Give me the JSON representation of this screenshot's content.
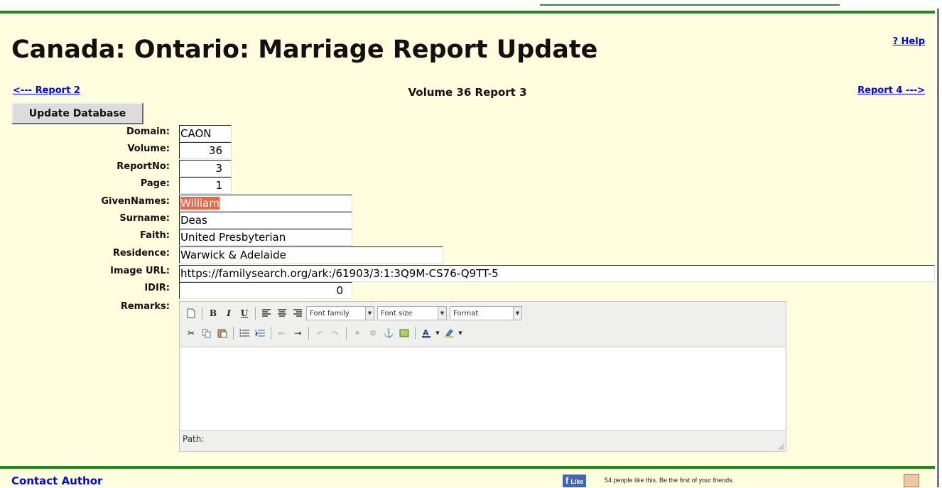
{
  "header": {
    "title": "Canada: Ontario: Marriage Report Update",
    "help_link": "? Help"
  },
  "nav": {
    "prev_link": "<--- Report 2",
    "next_link": "Report 4 --->",
    "volume_title": "Volume 36 Report 3"
  },
  "actions": {
    "update_button": "Update Database"
  },
  "form": {
    "domain": {
      "label": "Domain:",
      "value": "CAON"
    },
    "volume": {
      "label": "Volume:",
      "value": "36"
    },
    "report_no": {
      "label": "ReportNo:",
      "value": "3"
    },
    "page": {
      "label": "Page:",
      "value": "1"
    },
    "given_names": {
      "label": "GivenNames:",
      "value": "William"
    },
    "surname": {
      "label": "Surname:",
      "value": "Deas"
    },
    "faith": {
      "label": "Faith:",
      "value": "United Presbyterian"
    },
    "residence": {
      "label": "Residence:",
      "value": "Warwick & Adelaide"
    },
    "image_url": {
      "label": "Image URL:",
      "value": "https://familysearch.org/ark:/61903/3:1:3Q9M-CS76-Q9TT-5"
    },
    "idir": {
      "label": "IDIR:",
      "value": "0"
    },
    "remarks": {
      "label": "Remarks:"
    }
  },
  "editor": {
    "font_family": "Font family",
    "font_size": "Font size",
    "format": "Format",
    "path_label": "Path:"
  },
  "footer": {
    "contact": "Contact Author",
    "fb_like": "Like",
    "fb_text": "54 people like this. Be the first of your friends."
  }
}
